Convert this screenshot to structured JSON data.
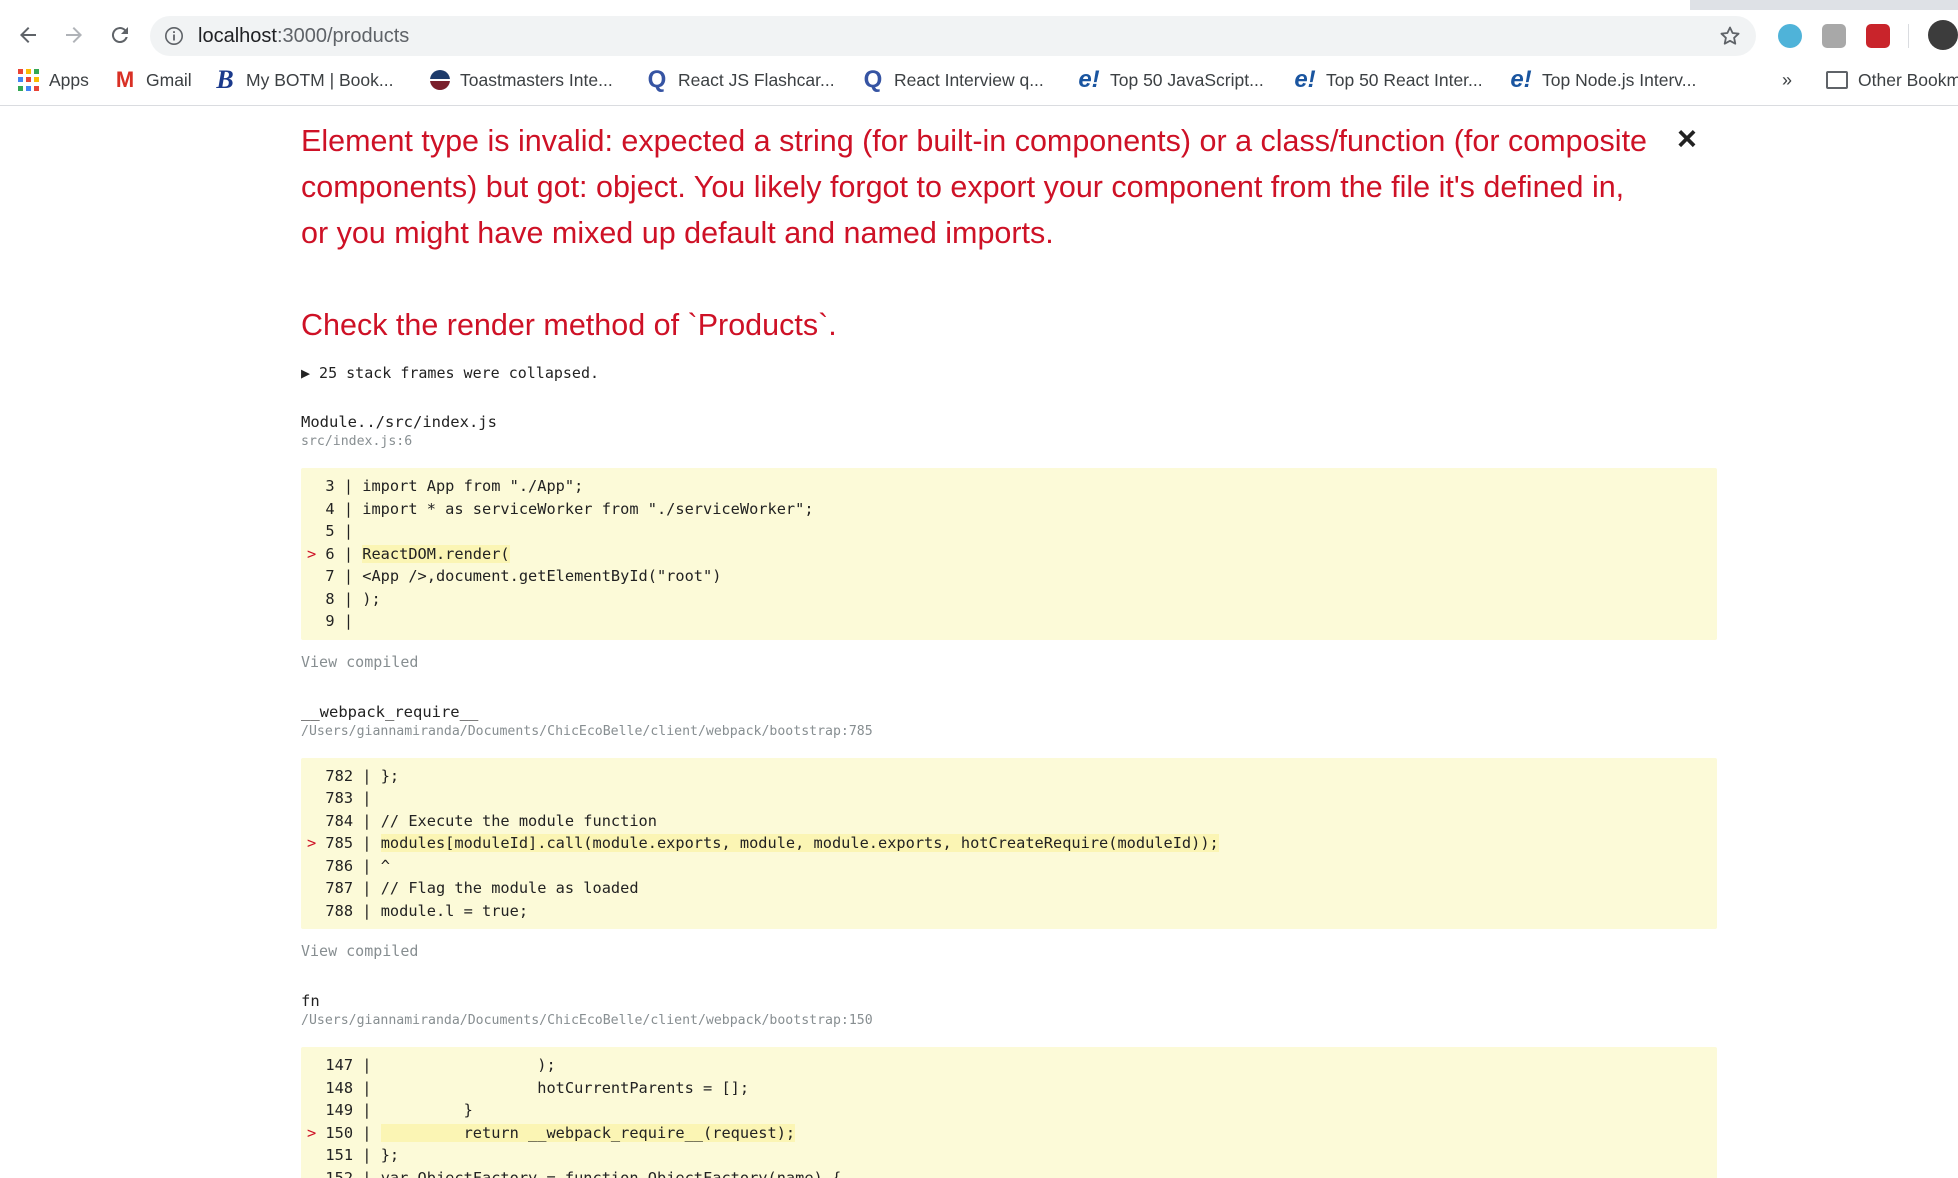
{
  "browser": {
    "url_host": "localhost",
    "url_path": ":3000/products",
    "bookmarks": [
      {
        "label": "Apps",
        "icon": "apps-grid-icon"
      },
      {
        "label": "Gmail",
        "icon": "gmail-icon"
      },
      {
        "label": "My BOTM | Book...",
        "icon": "botm-icon"
      },
      {
        "label": "Toastmasters Inte...",
        "icon": "toastmasters-icon"
      },
      {
        "label": "React JS Flashcar...",
        "icon": "quizlet-icon"
      },
      {
        "label": "React Interview q...",
        "icon": "quizlet-icon"
      },
      {
        "label": "Top 50 JavaScript...",
        "icon": "edureka-icon"
      },
      {
        "label": "Top 50 React Inter...",
        "icon": "edureka-icon"
      },
      {
        "label": "Top Node.js Interv...",
        "icon": "edureka-icon"
      }
    ],
    "overflow_label": "»",
    "other_bookmarks": "Other Bookm"
  },
  "error": {
    "title": "Element type is invalid: expected a string (for built-in components) or a class/function (for composite components) but got: object. You likely forgot to export your component from the file it's defined in, or you might have mixed up default and named imports.",
    "check": "Check the render method of `Products`.",
    "close": "×",
    "collapsed": "▶ 25 stack frames were collapsed.",
    "view_compiled": "View compiled",
    "frames": [
      {
        "name": "Module../src/index.js",
        "file": "src/index.js:6",
        "lines": [
          {
            "num": "3",
            "code": "import App from \"./App\";",
            "hl": false
          },
          {
            "num": "4",
            "code": "import * as serviceWorker from \"./serviceWorker\";",
            "hl": false
          },
          {
            "num": "5",
            "code": "",
            "hl": false
          },
          {
            "num": "6",
            "code": "ReactDOM.render(",
            "hl": true
          },
          {
            "num": "7",
            "code": "<App />,document.getElementById(\"root\")",
            "hl": false
          },
          {
            "num": "8",
            "code": ");",
            "hl": false
          },
          {
            "num": "9",
            "code": "",
            "hl": false
          }
        ]
      },
      {
        "name": "__webpack_require__",
        "file": "/Users/giannamiranda/Documents/ChicEcoBelle/client/webpack/bootstrap:785",
        "lines": [
          {
            "num": "782",
            "code": "};",
            "hl": false
          },
          {
            "num": "783",
            "code": "",
            "hl": false
          },
          {
            "num": "784",
            "code": "// Execute the module function",
            "hl": false
          },
          {
            "num": "785",
            "code": "modules[moduleId].call(module.exports, module, module.exports, hotCreateRequire(moduleId));",
            "hl": true
          },
          {
            "num": "786",
            "code": "^",
            "hl": false
          },
          {
            "num": "787",
            "code": "// Flag the module as loaded",
            "hl": false
          },
          {
            "num": "788",
            "code": "module.l = true;",
            "hl": false
          }
        ]
      },
      {
        "name": "fn",
        "file": "/Users/giannamiranda/Documents/ChicEcoBelle/client/webpack/bootstrap:150",
        "lines": [
          {
            "num": "147",
            "code": "                 );",
            "hl": false
          },
          {
            "num": "148",
            "code": "                 hotCurrentParents = [];",
            "hl": false
          },
          {
            "num": "149",
            "code": "         }",
            "hl": false
          },
          {
            "num": "150",
            "code": "         return __webpack_require__(request);",
            "hl": true
          },
          {
            "num": "151",
            "code": "};",
            "hl": false
          },
          {
            "num": "152",
            "code": "var ObjectFactory = function ObjectFactory(name) {",
            "hl": false
          }
        ]
      }
    ]
  },
  "colors": {
    "error_red": "#ce1126",
    "code_bg": "#fcfad8",
    "code_highlight": "#fbf5b4"
  }
}
